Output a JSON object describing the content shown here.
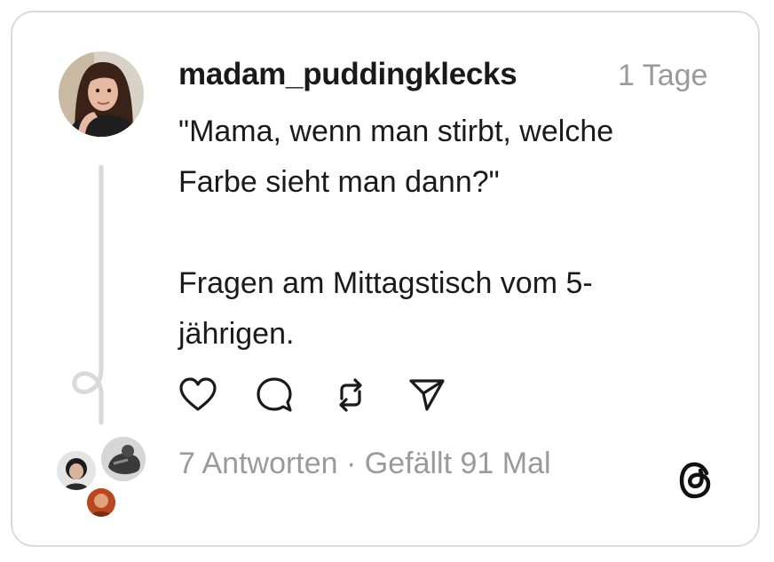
{
  "post": {
    "username": "madam_puddingklecks",
    "time_ago": "1 Tage",
    "text_line1": "\"Mama, wenn man stirbt, welche",
    "text_line2": "Farbe sieht man dann?\"",
    "text_line3": "Fragen am Mittagstisch vom 5-",
    "text_line4": "jährigen.",
    "stats": "7 Antworten · Gefällt 91 Mal"
  },
  "icons": {
    "like": "heart-icon",
    "reply": "comment-icon",
    "repost": "repost-icon",
    "share": "send-icon",
    "brand": "threads-logo"
  },
  "colors": {
    "text": "#1a1a1a",
    "muted": "#9a9a9a",
    "border": "#dbdbdb",
    "thread_line": "#d9d9d9"
  }
}
